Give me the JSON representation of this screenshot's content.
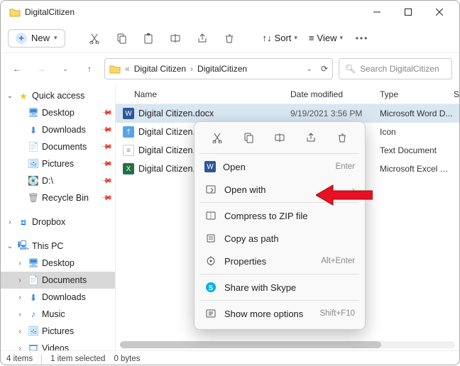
{
  "window": {
    "title": "DigitalCitizen"
  },
  "toolbar": {
    "new": "New",
    "sort": "Sort",
    "view": "View"
  },
  "breadcrumb": {
    "sep": "«",
    "p1": "Digital Citizen",
    "p2": "DigitalCitizen"
  },
  "search": {
    "placeholder": "Search DigitalCitizen"
  },
  "columns": {
    "name": "Name",
    "date": "Date modified",
    "type": "Type",
    "size": "S"
  },
  "files": [
    {
      "name": "Digital Citizen.docx",
      "date": "9/19/2021 3:56 PM",
      "type": "Microsoft Word D...",
      "iconBg": "#2b579a",
      "iconTx": "W"
    },
    {
      "name": "Digital Citizen.png",
      "date": "",
      "type": "Icon",
      "iconBg": "#5aa3e8",
      "iconTx": "†"
    },
    {
      "name": "Digital Citizen.txt",
      "date": "",
      "type": "Text Document",
      "iconBg": "#e8e8e8",
      "iconTx": ""
    },
    {
      "name": "Digital Citizen.xlsx",
      "date": "",
      "type": "Microsoft Excel W...",
      "iconBg": "#217346",
      "iconTx": "X"
    }
  ],
  "sidebar": {
    "quick": "Quick access",
    "desktop": "Desktop",
    "downloads": "Downloads",
    "documents": "Documents",
    "pictures": "Pictures",
    "ddrive": "D:\\",
    "recycle": "Recycle Bin",
    "dropbox": "Dropbox",
    "thispc": "This PC",
    "music": "Music",
    "videos": "Videos"
  },
  "context": {
    "open": "Open",
    "open_hint": "Enter",
    "openwith": "Open with",
    "compress": "Compress to ZIP file",
    "copypath": "Copy as path",
    "properties": "Properties",
    "properties_hint": "Alt+Enter",
    "skype": "Share with Skype",
    "more": "Show more options",
    "more_hint": "Shift+F10"
  },
  "status": {
    "count": "4 items",
    "sel": "1 item selected",
    "size": "0 bytes"
  }
}
